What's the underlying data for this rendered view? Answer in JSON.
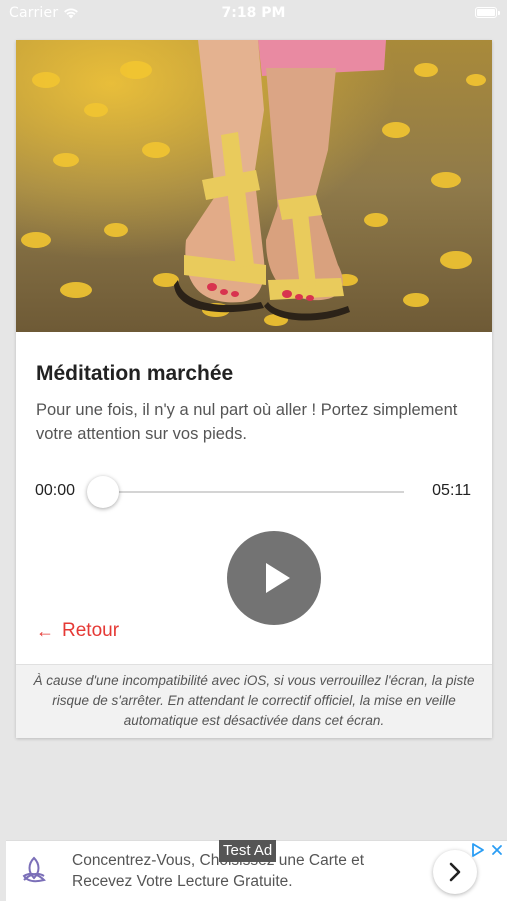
{
  "status_bar": {
    "carrier": "Carrier",
    "time": "7:18 PM"
  },
  "session": {
    "title": "Méditation marchée",
    "description": "Pour une fois, il n'y a nul part où aller ! Portez simplement votre attention sur vos pieds."
  },
  "player": {
    "current_time": "00:00",
    "duration": "05:11",
    "progress": 0
  },
  "back": {
    "label": "Retour"
  },
  "notice": {
    "text": "À cause d'une incompatibilité avec iOS, si vous verrouillez l'écran, la piste risque de s'arrêter. En attendant le correctif officiel, la mise en veille automatique est désactivée dans cet écran."
  },
  "ad": {
    "label": "Test Ad",
    "text": "Concentrez-Vous, Choisissez une Carte et Recevez Votre Lecture Gratuite."
  },
  "colors": {
    "accent": "#e53935",
    "play_button": "#737373",
    "background": "#e6e6e6"
  }
}
